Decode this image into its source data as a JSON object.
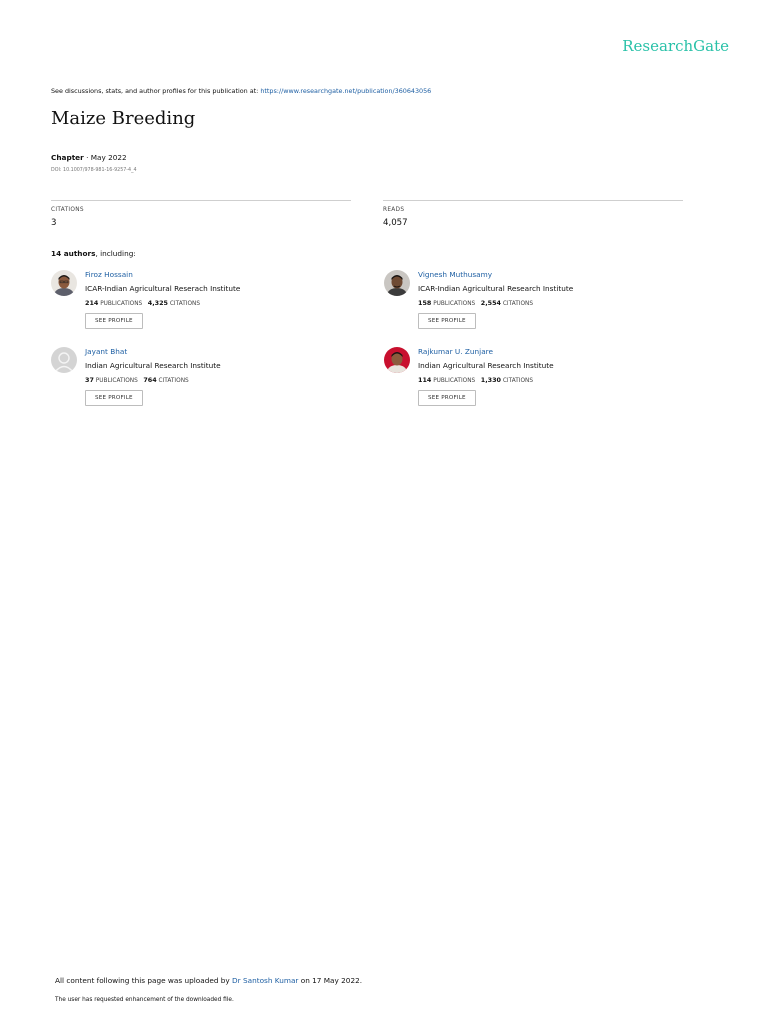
{
  "brand": "ResearchGate",
  "header": {
    "prefix": "See discussions, stats, and author profiles for this publication at: ",
    "url": "https://www.researchgate.net/publication/360643056"
  },
  "document": {
    "title": "Maize Breeding",
    "type": "Chapter",
    "date": "· May 2022",
    "doi": "DOI: 10.1007/978-981-16-9257-4_4"
  },
  "stats": {
    "citations_label": "CITATIONS",
    "citations_value": "3",
    "reads_label": "READS",
    "reads_value": "4,057"
  },
  "authors_heading": {
    "count": "14 authors",
    "suffix": ", including:"
  },
  "authors": [
    {
      "name": "Firoz Hossain",
      "institution": "ICAR-Indian Agricultural Reserach Institute",
      "publications": "214",
      "publications_label": "PUBLICATIONS",
      "citations": "4,325",
      "citations_label": "CITATIONS",
      "button": "SEE PROFILE"
    },
    {
      "name": "Vignesh Muthusamy",
      "institution": "ICAR-Indian Agricultural Research Institute",
      "publications": "158",
      "publications_label": "PUBLICATIONS",
      "citations": "2,554",
      "citations_label": "CITATIONS",
      "button": "SEE PROFILE"
    },
    {
      "name": "Jayant Bhat",
      "institution": "Indian Agricultural Research Institute",
      "publications": "37",
      "publications_label": "PUBLICATIONS",
      "citations": "764",
      "citations_label": "CITATIONS",
      "button": "SEE PROFILE"
    },
    {
      "name": "Rajkumar U. Zunjare",
      "institution": "Indian Agricultural Research Institute",
      "publications": "114",
      "publications_label": "PUBLICATIONS",
      "citations": "1,330",
      "citations_label": "CITATIONS",
      "button": "SEE PROFILE"
    }
  ],
  "footer": {
    "prefix": "All content following this page was uploaded by ",
    "uploader": "Dr Santosh Kumar",
    "suffix": " on 17 May 2022.",
    "note": "The user has requested enhancement of the downloaded file."
  },
  "colors": {
    "brand": "#29c1a8",
    "link": "#1e5fa3"
  }
}
